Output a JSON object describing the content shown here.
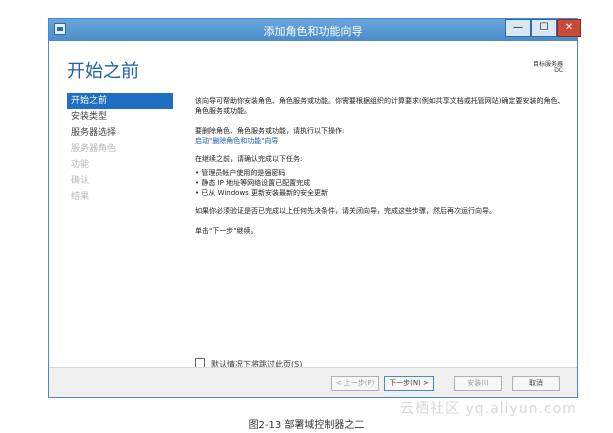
{
  "window": {
    "title": "添加角色和功能向导",
    "min_label": "—",
    "max_label": "☐",
    "close_label": "✕"
  },
  "page": {
    "title": "开始之前",
    "destination_label": "目标服务器",
    "destination_value": "DC"
  },
  "nav": {
    "items": [
      {
        "label": "开始之前",
        "state": "active"
      },
      {
        "label": "安装类型",
        "state": "normal"
      },
      {
        "label": "服务器选择",
        "state": "normal"
      },
      {
        "label": "服务器角色",
        "state": "disabled"
      },
      {
        "label": "功能",
        "state": "disabled"
      },
      {
        "label": "确认",
        "state": "disabled"
      },
      {
        "label": "结果",
        "state": "disabled"
      }
    ]
  },
  "main": {
    "para1": "该向导可帮助你安装角色、角色服务或功能。你需要根据组织的计算要求(例如共享文档或托管网站)确定要安装的角色、角色服务或功能。",
    "para2": "要删除角色、角色服务或功能，请执行以下操作:",
    "remove_link": "启动\"删除角色和功能\"向导",
    "para3": "在继续之前，请确认完成以下任务:",
    "bullets": [
      "• 管理员帐户使用的是强密码",
      "• 静态 IP 地址等网络设置已配置完成",
      "• 已从 Windows 更新安装最新的安全更新"
    ],
    "para4": "如果你必须验证是否已完成以上任何先决条件，请关闭向导，完成这些步骤，然后再次运行向导。",
    "para5": "单击\"下一步\"继续。"
  },
  "checkbox": {
    "label": "默认情况下将跳过此页(S)"
  },
  "footer": {
    "prev_label": "< 上一步(P)",
    "next_label": "下一步(N) >",
    "install_label": "安装(I)",
    "cancel_label": "取消"
  },
  "watermark": "云栖社区 yq.aliyun.com",
  "caption": "图2-13   部署域控制器之二"
}
